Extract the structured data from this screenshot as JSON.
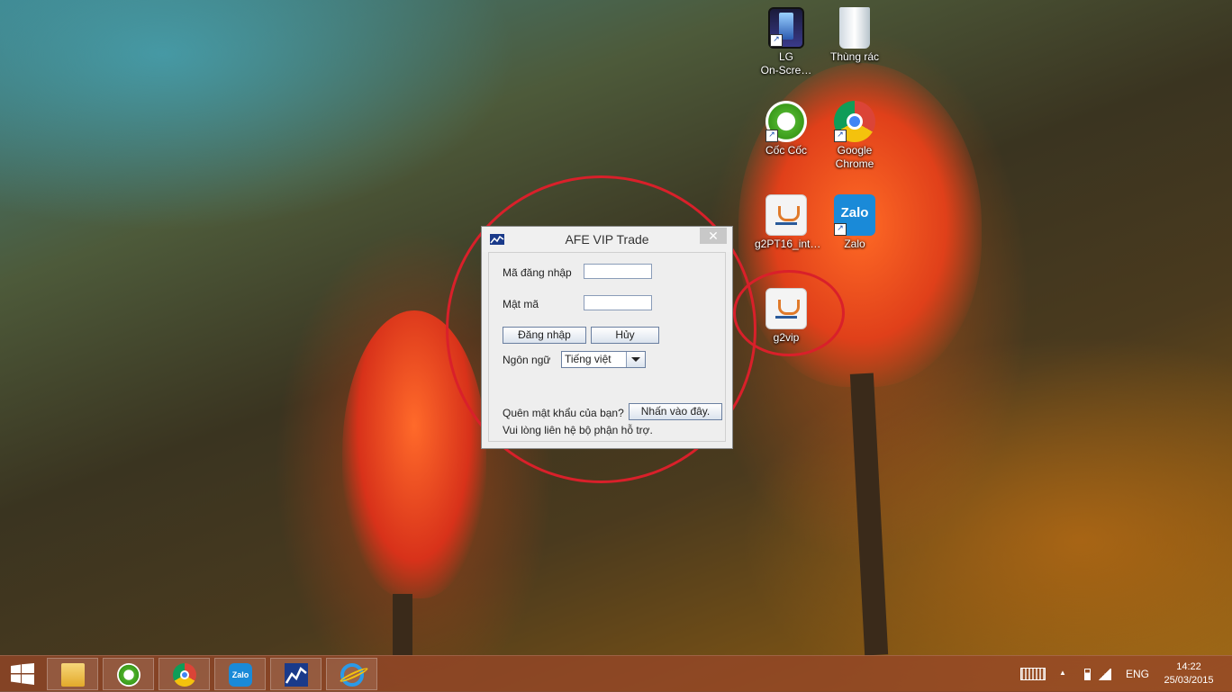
{
  "desktop_icons": [
    {
      "label": "LG\nOn-Scre…",
      "icon": "lg-onscreen-icon",
      "shortcut": true
    },
    {
      "label": "Thùng rác",
      "icon": "recycle-bin-icon",
      "shortcut": false
    },
    {
      "label": "Cốc Cốc",
      "icon": "coccoc-icon",
      "shortcut": true
    },
    {
      "label": "Google\nChrome",
      "icon": "chrome-icon",
      "shortcut": true
    },
    {
      "label": "g2PT16_int…",
      "icon": "java-icon",
      "shortcut": false
    },
    {
      "label": "Zalo",
      "icon": "zalo-icon",
      "shortcut": true
    },
    {
      "label": "g2vip",
      "icon": "java-icon",
      "shortcut": false
    }
  ],
  "dialog": {
    "title": "AFE VIP Trade",
    "close_glyph": "✕",
    "username_label": "Mã đăng nhập",
    "username_value": "",
    "password_label": "Mật mã",
    "password_value": "",
    "login_button": "Đăng nhập",
    "cancel_button": "Hủy",
    "language_label": "Ngôn ngữ",
    "language_selected": "Tiếng việt",
    "forgot_text": "Quên mật khẩu của bạn?",
    "forgot_link": "Nhấn vào đây.",
    "support_text": "Vui lòng liên hệ bộ phận hỗ trợ."
  },
  "zalo_icon_text": "Zalo",
  "taskbar": {
    "pinned": [
      "file-explorer-icon",
      "coccoc-icon",
      "chrome-icon",
      "zalo-icon",
      "afe-vip-trade-icon",
      "internet-explorer-icon"
    ],
    "language": "ENG",
    "time": "14:22",
    "date": "25/03/2015",
    "tray_up_arrow": "▲"
  },
  "colors": {
    "annotation": "#d9202a",
    "taskbar": "#964628"
  }
}
